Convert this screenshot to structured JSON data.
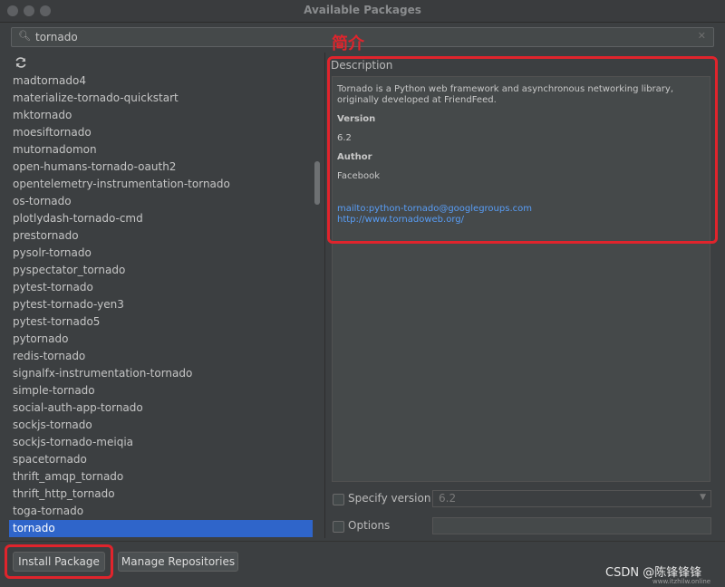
{
  "window": {
    "title": "Available Packages"
  },
  "search": {
    "value": "tornado"
  },
  "packages": [
    "madtornado4",
    "materialize-tornado-quickstart",
    "mktornado",
    "moesiftornado",
    "mutornadomon",
    "open-humans-tornado-oauth2",
    "opentelemetry-instrumentation-tornado",
    "os-tornado",
    "plotlydash-tornado-cmd",
    "prestornado",
    "pysolr-tornado",
    "pyspectator_tornado",
    "pytest-tornado",
    "pytest-tornado-yen3",
    "pytest-tornado5",
    "pytornado",
    "redis-tornado",
    "signalfx-instrumentation-tornado",
    "simple-tornado",
    "social-auth-app-tornado",
    "sockjs-tornado",
    "sockjs-tornado-meiqia",
    "spacetornado",
    "thrift_amqp_tornado",
    "thrift_http_tornado",
    "toga-tornado",
    "tornado"
  ],
  "selected_package": "tornado",
  "description": {
    "label": "Description",
    "summary": "Tornado is a Python web framework and asynchronous networking library, originally developed at FriendFeed.",
    "version_heading": "Version",
    "version": "6.2",
    "author_heading": "Author",
    "author": "Facebook",
    "email_link": "mailto:python-tornado@googlegroups.com",
    "homepage_link": "http://www.tornadoweb.org/"
  },
  "options": {
    "specify_version_label": "Specify version",
    "specify_version_value": "6.2",
    "options_label": "Options"
  },
  "buttons": {
    "install": "Install Package",
    "manage": "Manage Repositories"
  },
  "annotation": {
    "label": "简介",
    "color": "#e0242c"
  },
  "watermark": {
    "text": "CSDN @陈锋锋锋",
    "url": "www.itzhilw.online"
  },
  "colors": {
    "selection": "#2f65ca",
    "link": "#589df6",
    "background": "#3c3f41"
  },
  "icons": {
    "search": "search-icon",
    "refresh": "refresh-icon",
    "clear": "clear-icon"
  }
}
